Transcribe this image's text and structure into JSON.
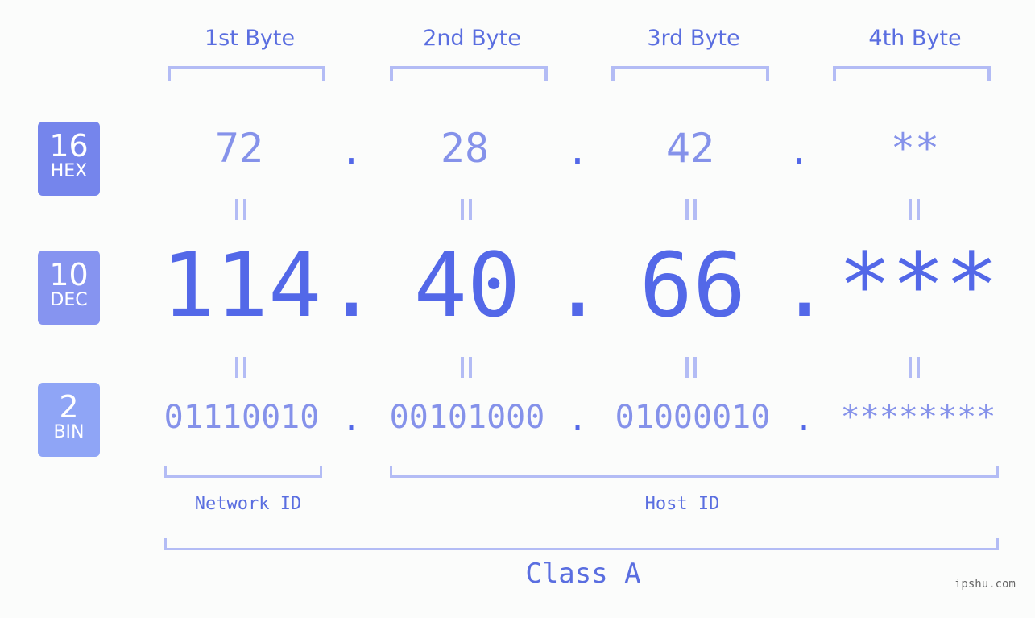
{
  "bytes": [
    {
      "label": "1st Byte",
      "hex": "72",
      "dec": "114",
      "bin": "01110010"
    },
    {
      "label": "2nd Byte",
      "hex": "28",
      "dec": "40",
      "bin": "00101000"
    },
    {
      "label": "3rd Byte",
      "hex": "42",
      "dec": "66",
      "bin": "01000010"
    },
    {
      "label": "4th Byte",
      "hex": "**",
      "dec": "***",
      "bin": "********"
    }
  ],
  "separator": ".",
  "badges": {
    "hex": {
      "number": "16",
      "label": "HEX",
      "color": "#7585ec"
    },
    "dec": {
      "number": "10",
      "label": "DEC",
      "color": "#8694f0"
    },
    "bin": {
      "number": "2",
      "label": "BIN",
      "color": "#8fa5f6"
    }
  },
  "network_id_label": "Network ID",
  "host_id_label": "Host ID",
  "class_label": "Class A",
  "watermark": "ipshu.com",
  "colors": {
    "accent": "#5368e8",
    "light": "#8592ea",
    "bracket": "#b3bcf5",
    "background": "#fbfcfb"
  }
}
